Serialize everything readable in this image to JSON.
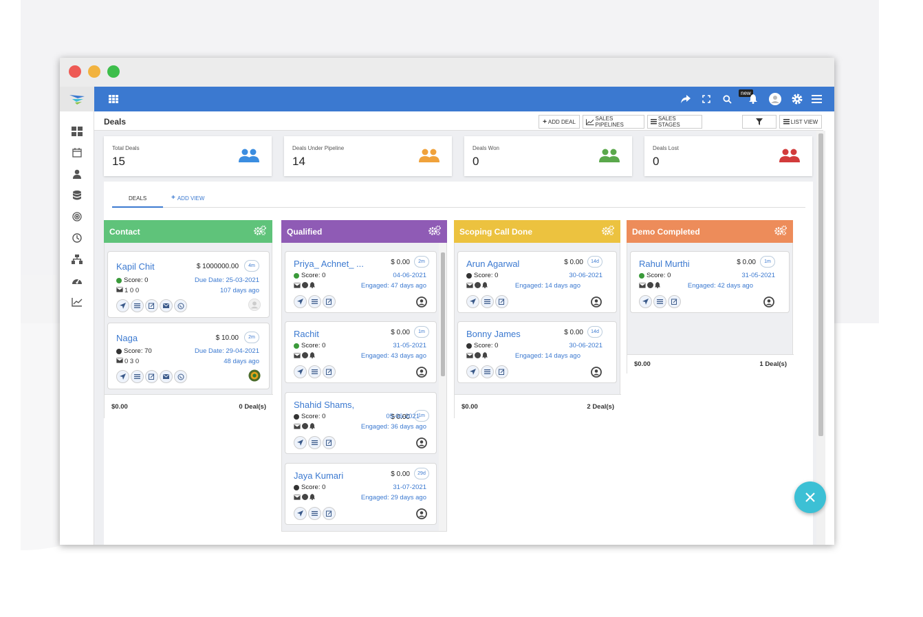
{
  "header": {
    "title": "Deals",
    "add_deal": "ADD DEAL",
    "sales_pipelines": "SALES PIPELINES",
    "sales_stages": "SALES STAGES",
    "list_view": "LIST VIEW"
  },
  "topbar": {
    "new_badge": "new"
  },
  "stats": [
    {
      "label": "Total Deals",
      "value": "15",
      "color": "#3b8de0"
    },
    {
      "label": "Deals Under Pipeline",
      "value": "14",
      "color": "#f0a23b"
    },
    {
      "label": "Deals Won",
      "value": "0",
      "color": "#5aa84b"
    },
    {
      "label": "Deals Lost",
      "value": "0",
      "color": "#d23b3b"
    }
  ],
  "tabs": {
    "deals": "DEALS",
    "add_view": "ADD VIEW"
  },
  "columns": [
    {
      "title": "Contact",
      "color": "#5fc37a",
      "total": "$0.00",
      "count": "0 Deal(s)",
      "cards": [
        {
          "name": "Kapil Chit",
          "amount": "$ 1000000.00",
          "age": "4m",
          "score": "Score: 0",
          "score_color": "#3a9a3a",
          "date": "Due Date: 25-03-2021",
          "meta": "1  0  0",
          "engaged": "107 days ago"
        },
        {
          "name": "Naga",
          "amount": "$ 10.00",
          "age": "2m",
          "score": "Score: 70",
          "score_color": "#333333",
          "date": "Due Date: 29-04-2021",
          "meta": "0  3  0",
          "engaged": "48 days ago"
        }
      ]
    },
    {
      "title": "Qualified",
      "color": "#8f5bb5",
      "cards": [
        {
          "name": "Priya_ Achnet_ ...",
          "amount": "$ 0.00",
          "age": "2m",
          "score": "Score: 0",
          "score_color": "#3a9a3a",
          "date": "04-06-2021",
          "engaged": "Engaged: 47 days ago"
        },
        {
          "name": "Rachit",
          "amount": "$ 0.00",
          "age": "1m",
          "score": "Score: 0",
          "score_color": "#3a9a3a",
          "date": "31-05-2021",
          "engaged": "Engaged: 43 days ago"
        },
        {
          "name": "Shahid Shams,",
          "amount": "$ 0.00",
          "age": "1m",
          "score": "Score: 0",
          "score_color": "#333333",
          "date": "05-06-2021",
          "engaged": "Engaged: 36 days ago"
        },
        {
          "name": "Jaya Kumari",
          "amount": "$ 0.00",
          "age": "29d",
          "score": "Score: 0",
          "score_color": "#333333",
          "date": "31-07-2021",
          "engaged": "Engaged: 29 days ago"
        }
      ]
    },
    {
      "title": "Scoping Call Done",
      "color": "#ecc23f",
      "total": "$0.00",
      "count": "2 Deal(s)",
      "cards": [
        {
          "name": "Arun Agarwal",
          "amount": "$ 0.00",
          "age": "14d",
          "score": "Score: 0",
          "score_color": "#333333",
          "date": "30-06-2021",
          "engaged": "Engaged: 14 days ago"
        },
        {
          "name": "Bonny James",
          "amount": "$ 0.00",
          "age": "14d",
          "score": "Score: 0",
          "score_color": "#333333",
          "date": "30-06-2021",
          "engaged": "Engaged: 14 days ago"
        }
      ]
    },
    {
      "title": "Demo Completed",
      "color": "#ed8c5a",
      "total": "$0.00",
      "count": "1 Deal(s)",
      "cards": [
        {
          "name": "Rahul Murthi",
          "amount": "$ 0.00",
          "age": "1m",
          "score": "Score: 0",
          "score_color": "#3a9a3a",
          "date": "31-05-2021",
          "engaged": "Engaged: 42 days ago"
        }
      ]
    }
  ],
  "colors": {
    "topbar": "#3b79d0",
    "link": "#3b79d0",
    "fab": "#3cc0d5"
  }
}
